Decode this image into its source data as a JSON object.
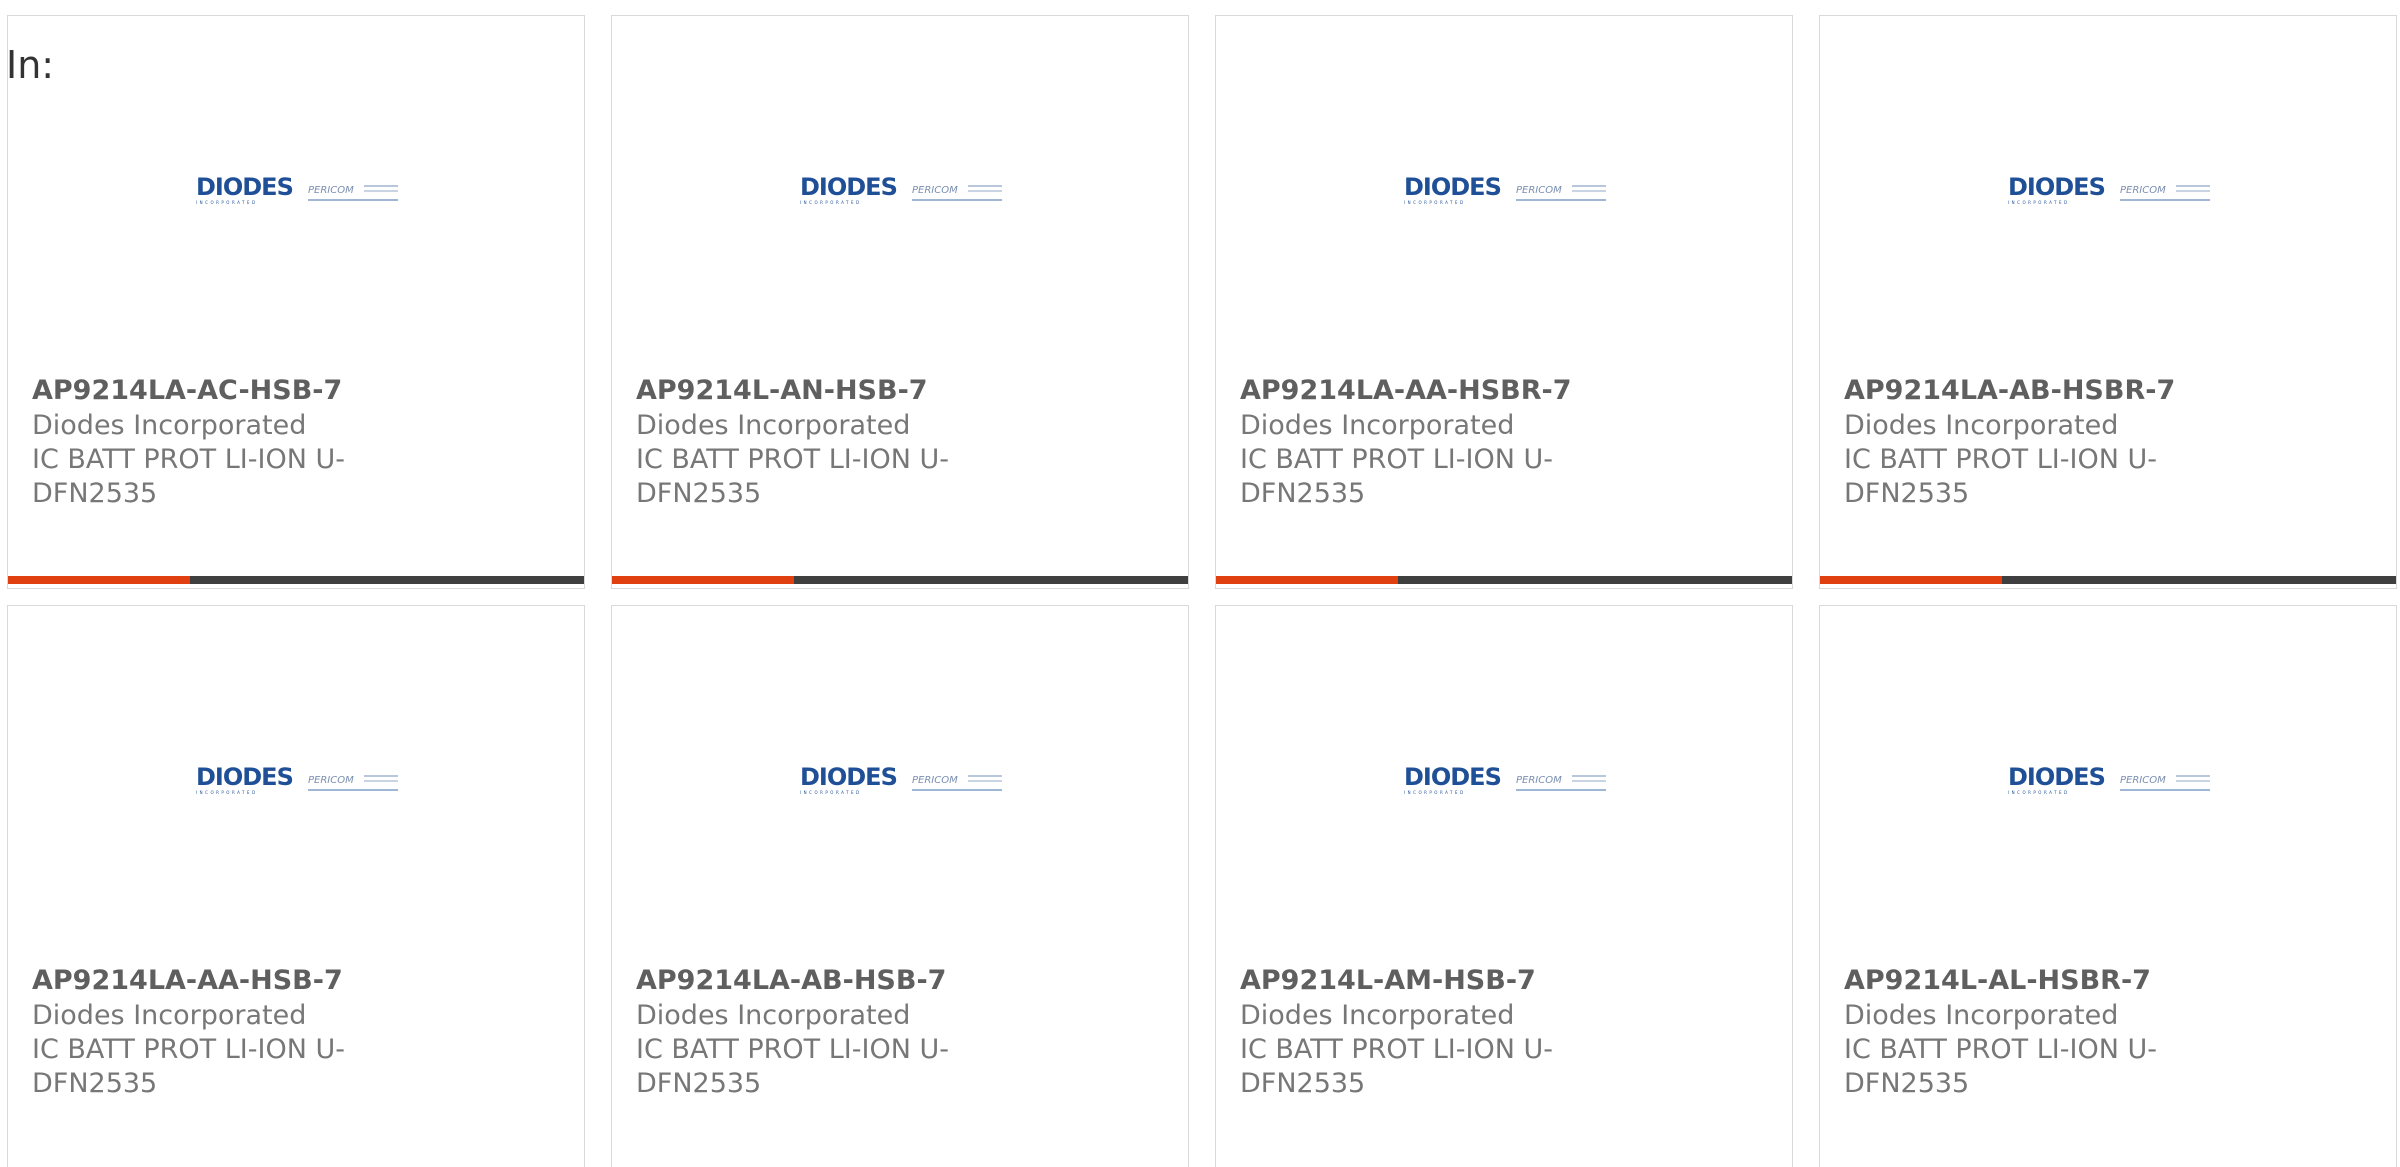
{
  "heading": "In:",
  "colors": {
    "accent": "#e0400f",
    "bar": "#3f3f3f",
    "logo_blue": "#1f4f96",
    "border": "#d9d9d9"
  },
  "products": [
    {
      "part": "AP9214LA-AC-HSB-7",
      "manufacturer": "Diodes Incorporated",
      "description": "IC BATT PROT LI-ION U-DFN2535",
      "logo": "diodes-pericom-logo"
    },
    {
      "part": "AP9214L-AN-HSB-7",
      "manufacturer": "Diodes Incorporated",
      "description": "IC BATT PROT LI-ION U-DFN2535",
      "logo": "diodes-pericom-logo"
    },
    {
      "part": "AP9214LA-AA-HSBR-7",
      "manufacturer": "Diodes Incorporated",
      "description": "IC BATT PROT LI-ION U-DFN2535",
      "logo": "diodes-pericom-logo"
    },
    {
      "part": "AP9214LA-AB-HSBR-7",
      "manufacturer": "Diodes Incorporated",
      "description": "IC BATT PROT LI-ION U-DFN2535",
      "logo": "diodes-pericom-logo"
    },
    {
      "part": "AP9214LA-AA-HSB-7",
      "manufacturer": "Diodes Incorporated",
      "description": "IC BATT PROT LI-ION U-DFN2535",
      "logo": "diodes-pericom-logo"
    },
    {
      "part": "AP9214LA-AB-HSB-7",
      "manufacturer": "Diodes Incorporated",
      "description": "IC BATT PROT LI-ION U-DFN2535",
      "logo": "diodes-pericom-logo"
    },
    {
      "part": "AP9214L-AM-HSB-7",
      "manufacturer": "Diodes Incorporated",
      "description": "IC BATT PROT LI-ION U-DFN2535",
      "logo": "diodes-pericom-logo"
    },
    {
      "part": "AP9214L-AL-HSBR-7",
      "manufacturer": "Diodes Incorporated",
      "description": "IC BATT PROT LI-ION U-DFN2535",
      "logo": "diodes-pericom-logo"
    }
  ],
  "logo_text": {
    "diodes": "DIODES",
    "diodes_sub": "INCORPORATED",
    "pericom": "PERICOM"
  }
}
